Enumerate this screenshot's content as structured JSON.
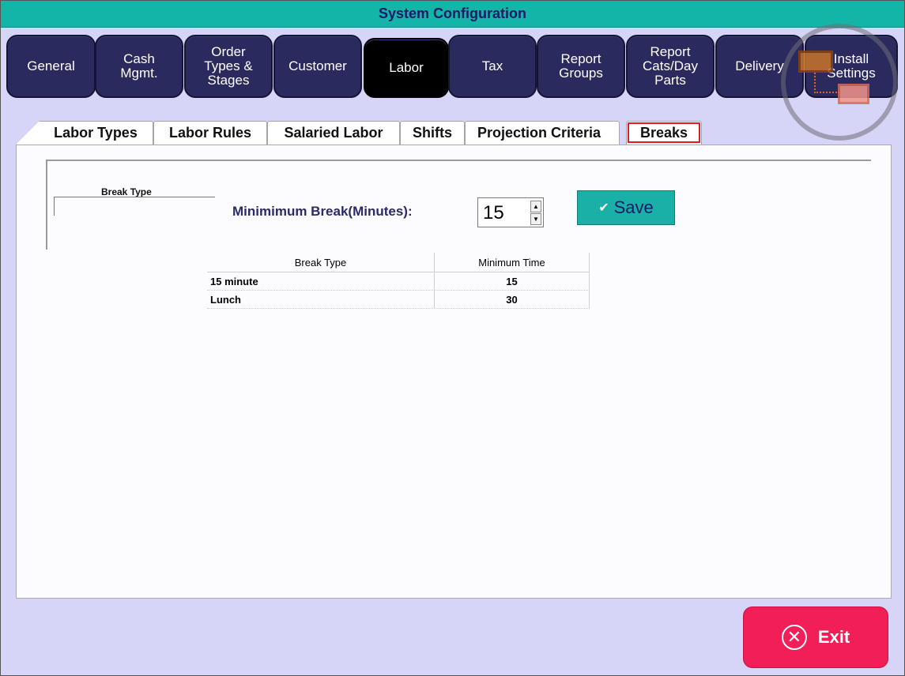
{
  "window": {
    "title": "System Configuration"
  },
  "main_tabs": [
    {
      "label": "General"
    },
    {
      "label": "Cash\nMgmt."
    },
    {
      "label": "Order\nTypes &\nStages"
    },
    {
      "label": "Customer"
    },
    {
      "label": "Labor",
      "active": true
    },
    {
      "label": "Tax"
    },
    {
      "label": "Report\nGroups"
    },
    {
      "label": "Report\nCats/Day\nParts"
    },
    {
      "label": "Delivery"
    },
    {
      "label": "Install\nSettings"
    }
  ],
  "sub_tabs": [
    {
      "label": "Labor Types"
    },
    {
      "label": "Labor Rules"
    },
    {
      "label": "Salaried Labor"
    },
    {
      "label": "Shifts"
    },
    {
      "label": "Projection Criteria"
    },
    {
      "label": "Breaks",
      "active": true
    }
  ],
  "breaks": {
    "group_title": "Break Type",
    "min_label": "Minimimum Break(Minutes):",
    "min_value": "15",
    "save_label": "Save"
  },
  "grid": {
    "headers": [
      "Break Type",
      "Minimum Time"
    ],
    "rows": [
      {
        "type": "15 minute",
        "time": "15"
      },
      {
        "type": "Lunch",
        "time": "30"
      }
    ]
  },
  "footer": {
    "exit_label": "Exit"
  },
  "colors": {
    "title_bar": "#12b5a7",
    "tab_bg": "#2a2a5e",
    "tab_active": "#000000",
    "save_button": "#1ab0a8",
    "exit_button": "#f21e57",
    "background": "#d7d5f7"
  },
  "icons": {
    "install_overlay": "remote-desktop-icon",
    "save": "check-icon",
    "exit": "close-circle-icon"
  }
}
